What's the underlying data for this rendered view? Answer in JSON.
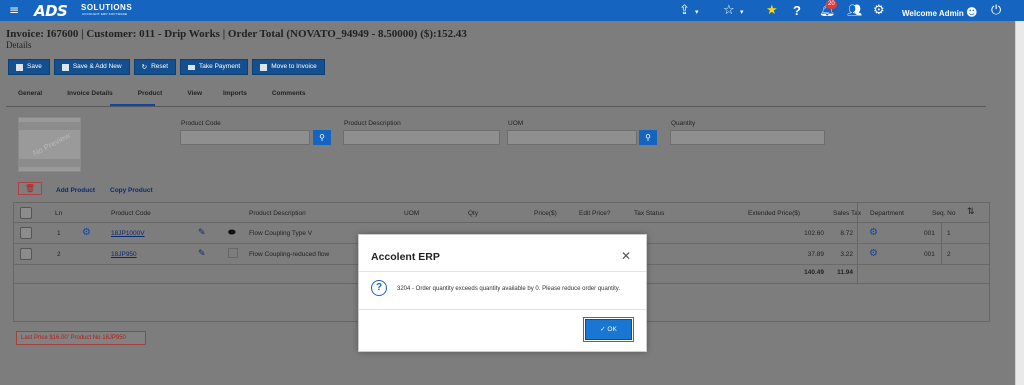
{
  "topbar": {
    "menu_icon": "menu-icon",
    "logo_big": "ADS",
    "logo_small": "SOLUTIONS",
    "logo_tag": "ACCOLENT ERP SOFTWARE",
    "notification_count": "20",
    "welcome": "Welcome Admin",
    "icons": [
      "share-icon",
      "star-outline-icon",
      "star-filled-icon",
      "help-icon",
      "bell-icon",
      "users-icon",
      "gear-icon",
      "user-icon",
      "power-icon"
    ]
  },
  "page": {
    "title": "Invoice: I67600 | Customer: 011 - Drip Works | Order Total (NOVATO_94949 - 8.50000) ($):152.43",
    "subtitle": "Details"
  },
  "toolbar": {
    "save": "Save",
    "save_add_new": "Save & Add New",
    "reset": "Reset",
    "take_payment": "Take Payment",
    "move_to_invoice": "Move to Invoice"
  },
  "tabs": [
    "General",
    "Invoice Details",
    "Product",
    "View",
    "Imports",
    "Comments"
  ],
  "active_tab": "Product",
  "product_form": {
    "no_preview": "No Preview",
    "product_code_label": "Product Code",
    "product_description_label": "Product Description",
    "uom_label": "UOM",
    "quantity_label": "Quantity"
  },
  "actions": {
    "add_product": "Add Product",
    "copy_product": "Copy Product"
  },
  "grid": {
    "headers": {
      "ln": "Ln",
      "product_code": "Product Code",
      "product_description": "Product Description",
      "uom": "UOM",
      "qty": "Qty",
      "price": "Price($)",
      "edit_price": "Edit Price?",
      "tax_status": "Tax Status",
      "extended_price": "Extended Price($)",
      "sales_tax": "Sales Tax",
      "department": "Department",
      "seq_no": "Seq. No"
    },
    "rows": [
      {
        "ln": "1",
        "code": "18JP1000V",
        "description": "Flow Coupling Type V",
        "extended": "102.60",
        "tax": "8.72",
        "dept": "001",
        "seq": "1"
      },
      {
        "ln": "2",
        "code": "18JP950",
        "description": "Flow Coupling-reduced flow",
        "extended": "37.89",
        "tax": "3.22",
        "dept": "001",
        "seq": "2"
      }
    ],
    "totals": {
      "extended": "140.49",
      "tax": "11.94"
    }
  },
  "last_price": "Last Price $16.00' Product No 18JP950",
  "modal": {
    "title": "Accolent ERP",
    "message": "3204 - Order quantity exceeds quantity available by 0. Please reduce order quantity.",
    "ok": "OK"
  },
  "colors": {
    "topbar": "#1565c0",
    "button": "#14508f",
    "link": "#0d2b6b",
    "ok": "#1976d2"
  }
}
